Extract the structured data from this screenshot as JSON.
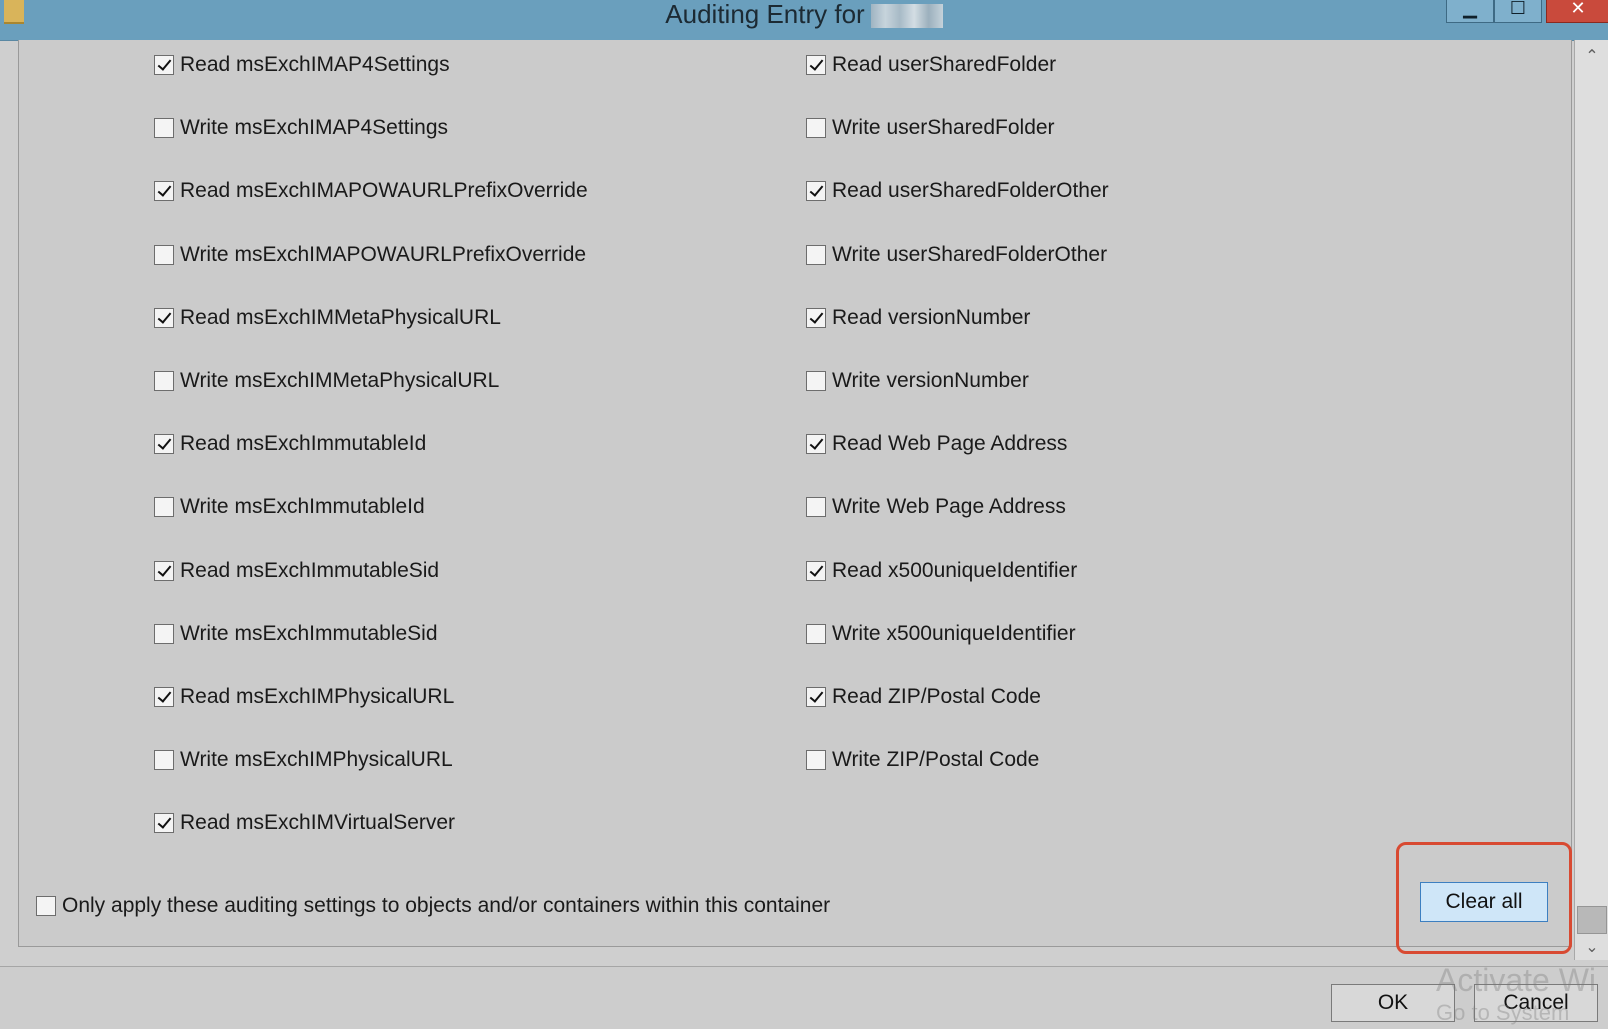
{
  "window": {
    "title": "Auditing Entry for",
    "minimize_glyph": "▁",
    "maximize_glyph": "☐",
    "close_glyph": "✕"
  },
  "left_column": [
    {
      "label": "Read msExchIMAP4Settings",
      "checked": true
    },
    {
      "label": "Write msExchIMAP4Settings",
      "checked": false
    },
    {
      "label": "Read msExchIMAPOWAURLPrefixOverride",
      "checked": true
    },
    {
      "label": "Write msExchIMAPOWAURLPrefixOverride",
      "checked": false
    },
    {
      "label": "Read msExchIMMetaPhysicalURL",
      "checked": true
    },
    {
      "label": "Write msExchIMMetaPhysicalURL",
      "checked": false
    },
    {
      "label": "Read msExchImmutableId",
      "checked": true
    },
    {
      "label": "Write msExchImmutableId",
      "checked": false
    },
    {
      "label": "Read msExchImmutableSid",
      "checked": true
    },
    {
      "label": "Write msExchImmutableSid",
      "checked": false
    },
    {
      "label": "Read msExchIMPhysicalURL",
      "checked": true
    },
    {
      "label": "Write msExchIMPhysicalURL",
      "checked": false
    },
    {
      "label": "Read msExchIMVirtualServer",
      "checked": true
    }
  ],
  "right_column": [
    {
      "label": "Read userSharedFolder",
      "checked": true
    },
    {
      "label": "Write userSharedFolder",
      "checked": false
    },
    {
      "label": "Read userSharedFolderOther",
      "checked": true
    },
    {
      "label": "Write userSharedFolderOther",
      "checked": false
    },
    {
      "label": "Read versionNumber",
      "checked": true
    },
    {
      "label": "Write versionNumber",
      "checked": false
    },
    {
      "label": "Read Web Page Address",
      "checked": true
    },
    {
      "label": "Write Web Page Address",
      "checked": false
    },
    {
      "label": "Read x500uniqueIdentifier",
      "checked": true
    },
    {
      "label": "Write x500uniqueIdentifier",
      "checked": false
    },
    {
      "label": "Read ZIP/Postal Code",
      "checked": true
    },
    {
      "label": "Write ZIP/Postal Code",
      "checked": false
    }
  ],
  "apply_only": {
    "label": "Only apply these auditing settings to objects and/or containers within this container",
    "checked": false
  },
  "buttons": {
    "clear_all": "Clear all",
    "ok": "OK",
    "cancel": "Cancel"
  },
  "watermark": {
    "line1": "Activate Wi",
    "line2": "Go to System"
  },
  "scroll": {
    "up_glyph": "⌃",
    "down_glyph": "⌄"
  },
  "colors": {
    "titlebar": "#6a9fbd",
    "highlight": "#d84a32",
    "clear_all_bg": "#cfe6f8"
  }
}
